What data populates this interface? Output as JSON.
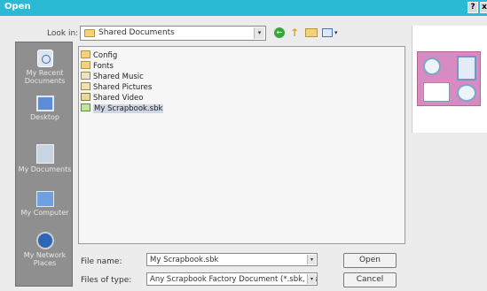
{
  "window": {
    "title": "Open",
    "help_label": "?",
    "close_label": "x"
  },
  "lookin": {
    "label": "Look in:",
    "value": "Shared Documents",
    "dropdown_glyph": "▾"
  },
  "toolbar": {
    "back_icon": "back-icon",
    "up_icon": "up-folder-icon",
    "new_folder_icon": "new-folder-icon",
    "views_icon": "views-menu-icon",
    "back_glyph": "←",
    "up_glyph": "↑",
    "views_caret": "▾"
  },
  "places": [
    {
      "label": "My Recent Documents",
      "icon": "recent-documents-icon"
    },
    {
      "label": "Desktop",
      "icon": "desktop-icon"
    },
    {
      "label": "My Documents",
      "icon": "my-documents-icon"
    },
    {
      "label": "My Computer",
      "icon": "my-computer-icon"
    },
    {
      "label": "My Network Places",
      "icon": "network-places-icon"
    }
  ],
  "files": [
    {
      "name": "Config",
      "icon": "folder-icon"
    },
    {
      "name": "Fonts",
      "icon": "folder-icon"
    },
    {
      "name": "Shared Music",
      "icon": "music-folder-icon"
    },
    {
      "name": "Shared Pictures",
      "icon": "pictures-folder-icon"
    },
    {
      "name": "Shared Video",
      "icon": "video-folder-icon"
    },
    {
      "name": "My Scrapbook.sbk",
      "icon": "scrapbook-file-icon",
      "selected": true
    }
  ],
  "filename": {
    "label": "File name:",
    "value": "My Scrapbook.sbk"
  },
  "filetype": {
    "label": "Files of type:",
    "value": "Any Scrapbook Factory Document (*.sbk, *.sjd, *"
  },
  "buttons": {
    "open": "Open",
    "cancel": "Cancel"
  },
  "colors": {
    "titlebar": "#2bbad3",
    "places_bar": "#8f8f8f",
    "selection": "#cfd7e6"
  }
}
